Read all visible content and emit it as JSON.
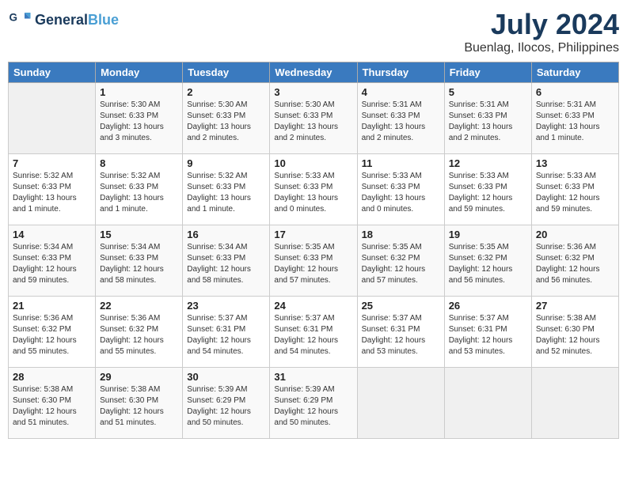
{
  "header": {
    "logo_general": "General",
    "logo_blue": "Blue",
    "month_year": "July 2024",
    "location": "Buenlag, Ilocos, Philippines"
  },
  "days_of_week": [
    "Sunday",
    "Monday",
    "Tuesday",
    "Wednesday",
    "Thursday",
    "Friday",
    "Saturday"
  ],
  "weeks": [
    [
      {
        "day": "",
        "sunrise": "",
        "sunset": "",
        "daylight": "",
        "empty": true
      },
      {
        "day": "1",
        "sunrise": "Sunrise: 5:30 AM",
        "sunset": "Sunset: 6:33 PM",
        "daylight": "Daylight: 13 hours and 3 minutes."
      },
      {
        "day": "2",
        "sunrise": "Sunrise: 5:30 AM",
        "sunset": "Sunset: 6:33 PM",
        "daylight": "Daylight: 13 hours and 2 minutes."
      },
      {
        "day": "3",
        "sunrise": "Sunrise: 5:30 AM",
        "sunset": "Sunset: 6:33 PM",
        "daylight": "Daylight: 13 hours and 2 minutes."
      },
      {
        "day": "4",
        "sunrise": "Sunrise: 5:31 AM",
        "sunset": "Sunset: 6:33 PM",
        "daylight": "Daylight: 13 hours and 2 minutes."
      },
      {
        "day": "5",
        "sunrise": "Sunrise: 5:31 AM",
        "sunset": "Sunset: 6:33 PM",
        "daylight": "Daylight: 13 hours and 2 minutes."
      },
      {
        "day": "6",
        "sunrise": "Sunrise: 5:31 AM",
        "sunset": "Sunset: 6:33 PM",
        "daylight": "Daylight: 13 hours and 1 minute."
      }
    ],
    [
      {
        "day": "7",
        "sunrise": "Sunrise: 5:32 AM",
        "sunset": "Sunset: 6:33 PM",
        "daylight": "Daylight: 13 hours and 1 minute."
      },
      {
        "day": "8",
        "sunrise": "Sunrise: 5:32 AM",
        "sunset": "Sunset: 6:33 PM",
        "daylight": "Daylight: 13 hours and 1 minute."
      },
      {
        "day": "9",
        "sunrise": "Sunrise: 5:32 AM",
        "sunset": "Sunset: 6:33 PM",
        "daylight": "Daylight: 13 hours and 1 minute."
      },
      {
        "day": "10",
        "sunrise": "Sunrise: 5:33 AM",
        "sunset": "Sunset: 6:33 PM",
        "daylight": "Daylight: 13 hours and 0 minutes."
      },
      {
        "day": "11",
        "sunrise": "Sunrise: 5:33 AM",
        "sunset": "Sunset: 6:33 PM",
        "daylight": "Daylight: 13 hours and 0 minutes."
      },
      {
        "day": "12",
        "sunrise": "Sunrise: 5:33 AM",
        "sunset": "Sunset: 6:33 PM",
        "daylight": "Daylight: 12 hours and 59 minutes."
      },
      {
        "day": "13",
        "sunrise": "Sunrise: 5:33 AM",
        "sunset": "Sunset: 6:33 PM",
        "daylight": "Daylight: 12 hours and 59 minutes."
      }
    ],
    [
      {
        "day": "14",
        "sunrise": "Sunrise: 5:34 AM",
        "sunset": "Sunset: 6:33 PM",
        "daylight": "Daylight: 12 hours and 59 minutes."
      },
      {
        "day": "15",
        "sunrise": "Sunrise: 5:34 AM",
        "sunset": "Sunset: 6:33 PM",
        "daylight": "Daylight: 12 hours and 58 minutes."
      },
      {
        "day": "16",
        "sunrise": "Sunrise: 5:34 AM",
        "sunset": "Sunset: 6:33 PM",
        "daylight": "Daylight: 12 hours and 58 minutes."
      },
      {
        "day": "17",
        "sunrise": "Sunrise: 5:35 AM",
        "sunset": "Sunset: 6:33 PM",
        "daylight": "Daylight: 12 hours and 57 minutes."
      },
      {
        "day": "18",
        "sunrise": "Sunrise: 5:35 AM",
        "sunset": "Sunset: 6:32 PM",
        "daylight": "Daylight: 12 hours and 57 minutes."
      },
      {
        "day": "19",
        "sunrise": "Sunrise: 5:35 AM",
        "sunset": "Sunset: 6:32 PM",
        "daylight": "Daylight: 12 hours and 56 minutes."
      },
      {
        "day": "20",
        "sunrise": "Sunrise: 5:36 AM",
        "sunset": "Sunset: 6:32 PM",
        "daylight": "Daylight: 12 hours and 56 minutes."
      }
    ],
    [
      {
        "day": "21",
        "sunrise": "Sunrise: 5:36 AM",
        "sunset": "Sunset: 6:32 PM",
        "daylight": "Daylight: 12 hours and 55 minutes."
      },
      {
        "day": "22",
        "sunrise": "Sunrise: 5:36 AM",
        "sunset": "Sunset: 6:32 PM",
        "daylight": "Daylight: 12 hours and 55 minutes."
      },
      {
        "day": "23",
        "sunrise": "Sunrise: 5:37 AM",
        "sunset": "Sunset: 6:31 PM",
        "daylight": "Daylight: 12 hours and 54 minutes."
      },
      {
        "day": "24",
        "sunrise": "Sunrise: 5:37 AM",
        "sunset": "Sunset: 6:31 PM",
        "daylight": "Daylight: 12 hours and 54 minutes."
      },
      {
        "day": "25",
        "sunrise": "Sunrise: 5:37 AM",
        "sunset": "Sunset: 6:31 PM",
        "daylight": "Daylight: 12 hours and 53 minutes."
      },
      {
        "day": "26",
        "sunrise": "Sunrise: 5:37 AM",
        "sunset": "Sunset: 6:31 PM",
        "daylight": "Daylight: 12 hours and 53 minutes."
      },
      {
        "day": "27",
        "sunrise": "Sunrise: 5:38 AM",
        "sunset": "Sunset: 6:30 PM",
        "daylight": "Daylight: 12 hours and 52 minutes."
      }
    ],
    [
      {
        "day": "28",
        "sunrise": "Sunrise: 5:38 AM",
        "sunset": "Sunset: 6:30 PM",
        "daylight": "Daylight: 12 hours and 51 minutes."
      },
      {
        "day": "29",
        "sunrise": "Sunrise: 5:38 AM",
        "sunset": "Sunset: 6:30 PM",
        "daylight": "Daylight: 12 hours and 51 minutes."
      },
      {
        "day": "30",
        "sunrise": "Sunrise: 5:39 AM",
        "sunset": "Sunset: 6:29 PM",
        "daylight": "Daylight: 12 hours and 50 minutes."
      },
      {
        "day": "31",
        "sunrise": "Sunrise: 5:39 AM",
        "sunset": "Sunset: 6:29 PM",
        "daylight": "Daylight: 12 hours and 50 minutes."
      },
      {
        "day": "",
        "sunrise": "",
        "sunset": "",
        "daylight": "",
        "empty": true
      },
      {
        "day": "",
        "sunrise": "",
        "sunset": "",
        "daylight": "",
        "empty": true
      },
      {
        "day": "",
        "sunrise": "",
        "sunset": "",
        "daylight": "",
        "empty": true
      }
    ]
  ]
}
